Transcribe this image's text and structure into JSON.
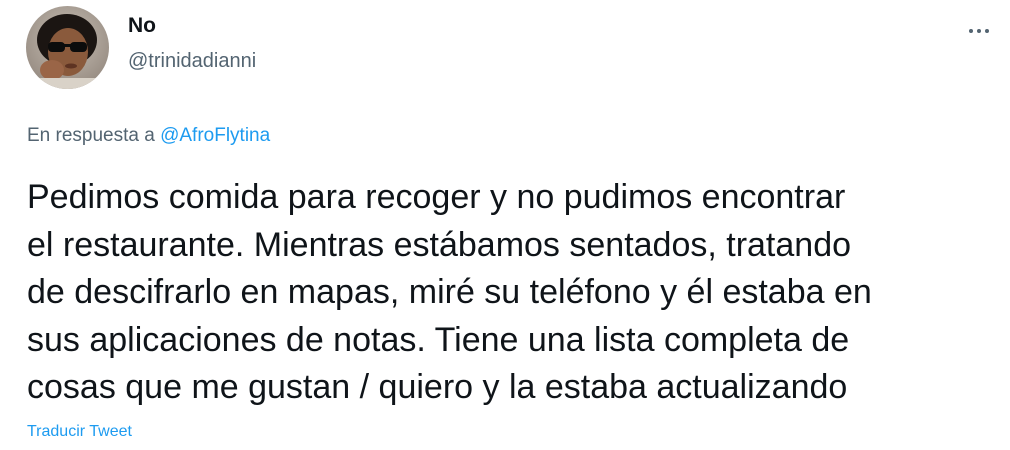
{
  "tweet": {
    "display_name": "No",
    "handle": "@trinidadianni",
    "reply_prefix": "En respuesta a",
    "reply_mention": "@AfroFlytina",
    "body_lines": [
      "Pedimos comida para recoger y no pudimos encontrar",
      "el restaurante. Mientras estábamos sentados, tratando",
      "de descifrarlo en mapas, miré su teléfono y él estaba en",
      "sus aplicaciones de notas. Tiene una lista completa de",
      "cosas que me gustan / quiero y la estaba actualizando"
    ],
    "translate_label": "Traducir Tweet"
  },
  "icons": {
    "more": "more-horizontal-icon",
    "avatar": "profile-photo"
  },
  "colors": {
    "text_primary": "#0f1419",
    "text_secondary": "#536471",
    "accent": "#1d9bf0",
    "background": "#ffffff"
  }
}
